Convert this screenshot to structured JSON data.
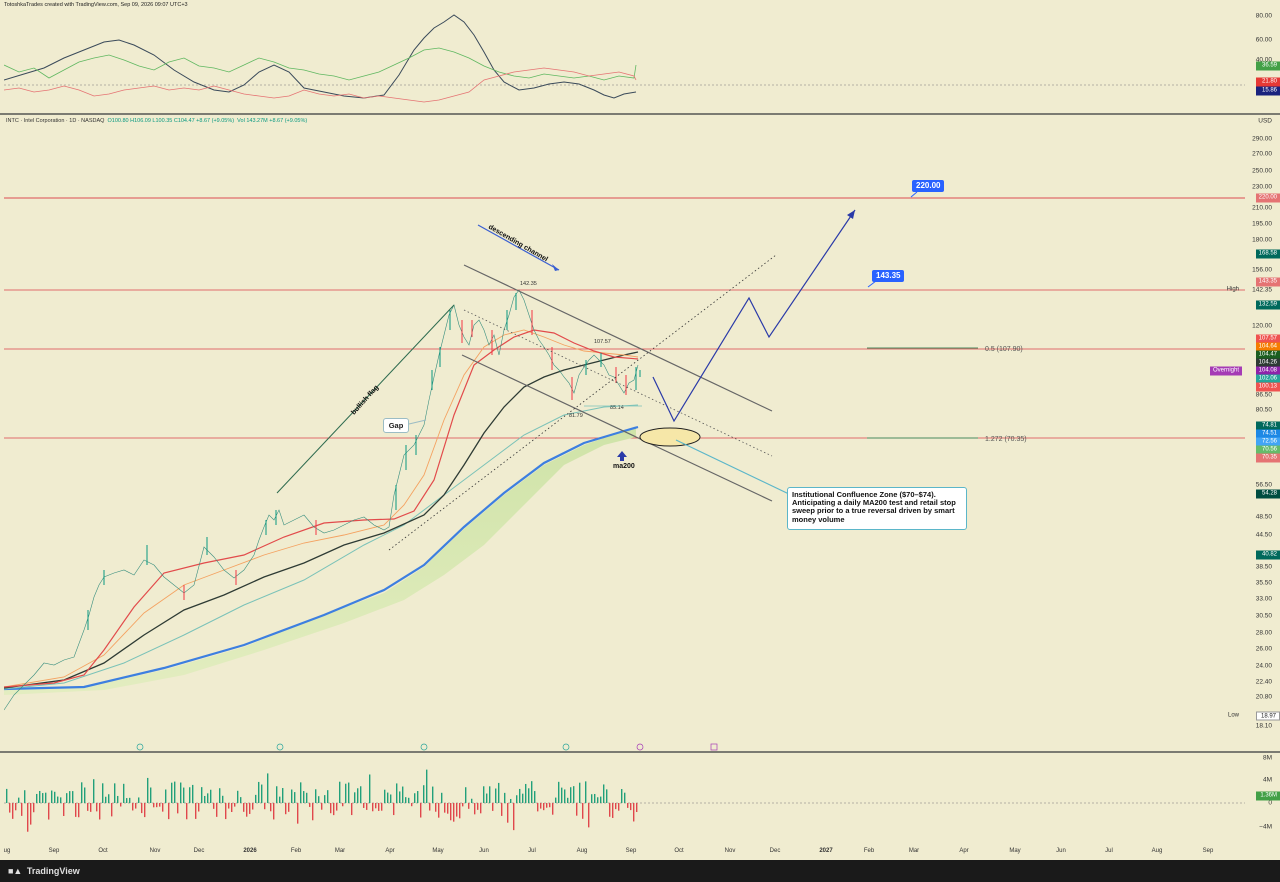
{
  "header": {
    "caption": "TotoshkaTrades created with TradingView.com, Sep 09, 2026 09:07 UTC+3"
  },
  "symbol_legend": {
    "symbol": "INTC · Intel Corporation · 1D · NASDAQ",
    "ohlc": "O100.80  H106.09  L100.35  C104.47 +8.67 (+9.05%)",
    "vol": "Vol 143.27M +8.67 (+9.05%)"
  },
  "currency": "USD",
  "oscillator": {
    "ticks": [
      "80.00",
      "60.00",
      "40.00"
    ],
    "badges": [
      {
        "value": "36.59",
        "color": "#43a047"
      },
      {
        "value": "21.80",
        "color": "#e53935"
      },
      {
        "value": "15.86",
        "color": "#1a237e"
      }
    ]
  },
  "price_axis": {
    "ticks": [
      "290.00",
      "270.00",
      "250.00",
      "230.00",
      "210.00",
      "195.00",
      "180.00",
      "156.00",
      "142.35",
      "120.00",
      "86.50",
      "80.50",
      "56.50",
      "48.50",
      "44.50",
      "38.50",
      "35.50",
      "33.00",
      "30.50",
      "28.00",
      "26.00",
      "24.00",
      "22.40",
      "20.80",
      "18.10"
    ],
    "badges": [
      {
        "value": "220.00",
        "color": "#e57373"
      },
      {
        "value": "168.58",
        "color": "#00695c"
      },
      {
        "value": "143.35",
        "color": "#e57373"
      },
      {
        "value": "132.59",
        "color": "#00695c"
      },
      {
        "value": "107.57",
        "color": "#ef5350"
      },
      {
        "value": "104.64",
        "color": "#f57c00"
      },
      {
        "value": "104.47",
        "color": "#1b5e20"
      },
      {
        "value": "104.26",
        "color": "#2e3b34"
      },
      {
        "value": "104.08",
        "color": "#8e24aa"
      },
      {
        "value": "102.06",
        "color": "#26a69a"
      },
      {
        "value": "100.13",
        "color": "#ef5350"
      },
      {
        "value": "74.81",
        "color": "#00695c"
      },
      {
        "value": "74.51",
        "color": "#1e88e5"
      },
      {
        "value": "72.56",
        "color": "#42a5f5"
      },
      {
        "value": "70.56",
        "color": "#66bb6a"
      },
      {
        "value": "70.35",
        "color": "#e57373"
      },
      {
        "value": "54.28",
        "color": "#004d40"
      },
      {
        "value": "40.82",
        "color": "#00695c"
      },
      {
        "value": "18.97",
        "color": "#ffffff"
      }
    ],
    "high_label": "High",
    "low_label": "Low",
    "overnight_label": "Overnight"
  },
  "volume_axis": {
    "ticks": [
      "8M",
      "4M",
      "0",
      "−4M"
    ],
    "badge": "1.36M"
  },
  "time_axis": {
    "labels": [
      {
        "text": "ug",
        "bold": false
      },
      {
        "text": "Sep",
        "bold": false
      },
      {
        "text": "Oct",
        "bold": false
      },
      {
        "text": "Nov",
        "bold": false
      },
      {
        "text": "Dec",
        "bold": false
      },
      {
        "text": "2026",
        "bold": true
      },
      {
        "text": "Feb",
        "bold": false
      },
      {
        "text": "Mar",
        "bold": false
      },
      {
        "text": "Apr",
        "bold": false
      },
      {
        "text": "May",
        "bold": false
      },
      {
        "text": "Jun",
        "bold": false
      },
      {
        "text": "Jul",
        "bold": false
      },
      {
        "text": "Aug",
        "bold": false
      },
      {
        "text": "Sep",
        "bold": false
      },
      {
        "text": "Oct",
        "bold": false
      },
      {
        "text": "Nov",
        "bold": false
      },
      {
        "text": "Dec",
        "bold": false
      },
      {
        "text": "2027",
        "bold": true
      },
      {
        "text": "Feb",
        "bold": false
      },
      {
        "text": "Mar",
        "bold": false
      },
      {
        "text": "Apr",
        "bold": false
      },
      {
        "text": "May",
        "bold": false
      },
      {
        "text": "Jun",
        "bold": false
      },
      {
        "text": "Jul",
        "bold": false
      },
      {
        "text": "Aug",
        "bold": false
      },
      {
        "text": "Sep",
        "bold": false
      }
    ]
  },
  "annotations": {
    "target_top": "220.00",
    "target_mid": "143.35",
    "fib_05": "0.5 (107.90)",
    "fib_1272": "1.272 (70.35)",
    "bullish_flag": "bullish flag",
    "descending_channel": "descending channel",
    "gap": "Gap",
    "ma200": "ma200",
    "peak_label": "142.35",
    "swing_high_label": "107.57",
    "swing_low_label": "81.79",
    "swing_low2_label": "85.14",
    "callout": "Institutional Confluence Zone ($70–$74). Anticipating a daily MA200 test and retail stop sweep prior to a true reversal driven by smart money volume"
  },
  "footer": {
    "brand": "TradingView"
  }
}
